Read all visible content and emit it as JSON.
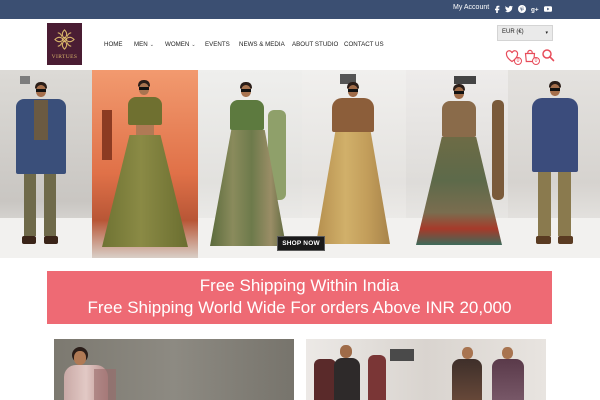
{
  "topbar": {
    "account_label": "My Account",
    "social": [
      "facebook-icon",
      "twitter-icon",
      "pinterest-icon",
      "google-plus-icon",
      "youtube-icon"
    ]
  },
  "header": {
    "logo_text": "VIRTUES",
    "nav": [
      {
        "label": "HOME",
        "has_dropdown": false
      },
      {
        "label": "MEN",
        "has_dropdown": true
      },
      {
        "label": "WOMEN",
        "has_dropdown": true
      },
      {
        "label": "EVENTS",
        "has_dropdown": false
      },
      {
        "label": "NEWS & MEDIA",
        "has_dropdown": false
      },
      {
        "label": "ABOUT STUDIO",
        "has_dropdown": false
      },
      {
        "label": "CONTACT US",
        "has_dropdown": false
      }
    ],
    "currency": "EUR (€)",
    "wishlist_count": "0",
    "cart_count": "0"
  },
  "hero": {
    "cta_label": "SHOP NOW"
  },
  "promo": {
    "line1": "Free Shipping Within India",
    "line2": "Free Shipping World Wide For orders Above INR 20,000"
  },
  "colors": {
    "topbar": "#3b4f72",
    "logo_bg": "#4a1d33",
    "logo_gold": "#d8b56a",
    "promo_bg": "#ee6a74",
    "accent": "#e74c5a"
  }
}
